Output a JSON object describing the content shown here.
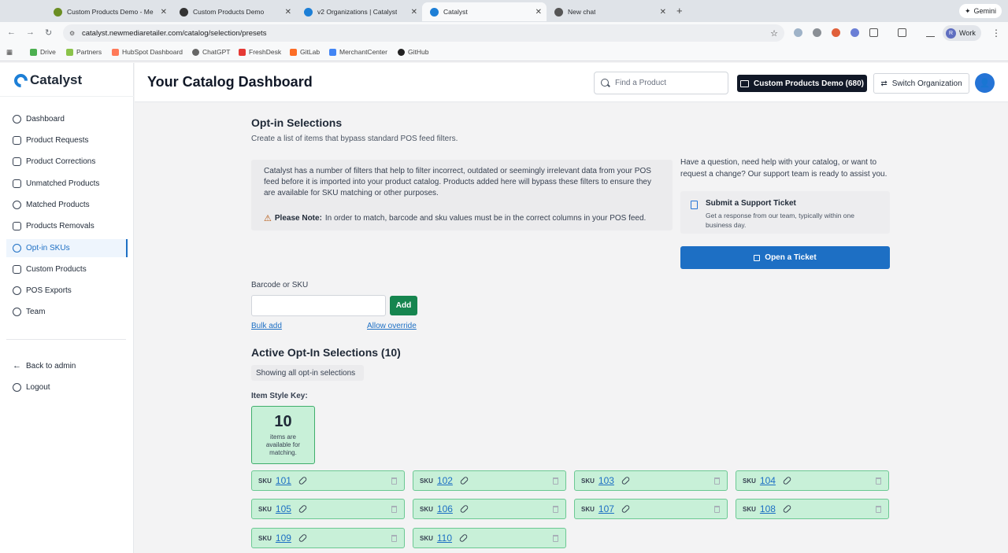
{
  "browser": {
    "tabs": [
      {
        "label": "Custom Products Demo - Me",
        "icon_color": "#6b8e23"
      },
      {
        "label": "Custom Products Demo",
        "icon_color": "#333333"
      },
      {
        "label": "v2 Organizations | Catalyst",
        "icon_color": "#1d7fd6"
      },
      {
        "label": "Catalyst",
        "icon_color": "#1d7fd6"
      },
      {
        "label": "New chat",
        "icon_color": "#555555"
      }
    ],
    "gemini_label": "Gemini",
    "url": "catalyst.newmediaretailer.com/catalog/selection/presets",
    "profile_label": "Work",
    "profile_initial": "R",
    "bookmarks": [
      "Drive",
      "Partners",
      "HubSpot Dashboard",
      "ChatGPT",
      "FreshDesk",
      "GitLab",
      "MerchantCenter",
      "GitHub"
    ]
  },
  "app": {
    "logo_text": "Catalyst",
    "page_title": "Your Catalog Dashboard",
    "search_placeholder": "Find a Product",
    "org_button": "Custom Products Demo (680)",
    "switch_org": "Switch Organization",
    "accent": "#1d6fc4"
  },
  "sidebar": {
    "items": [
      {
        "label": "Dashboard",
        "icon": "dashboard-icon"
      },
      {
        "label": "Product Requests",
        "icon": "list-icon"
      },
      {
        "label": "Product Corrections",
        "icon": "edit-icon"
      },
      {
        "label": "Unmatched Products",
        "icon": "inbox-icon"
      },
      {
        "label": "Matched Products",
        "icon": "check-circle-icon"
      },
      {
        "label": "Products Removals",
        "icon": "trash-icon"
      },
      {
        "label": "Opt-in SKUs",
        "icon": "gear-icon",
        "active": true
      },
      {
        "label": "Custom Products",
        "icon": "box-icon"
      },
      {
        "label": "POS Exports",
        "icon": "users-icon"
      },
      {
        "label": "Team",
        "icon": "team-icon"
      }
    ],
    "footer": [
      {
        "label": "Back to admin",
        "icon": "arrow-left-icon"
      },
      {
        "label": "Logout",
        "icon": "power-icon"
      }
    ]
  },
  "main": {
    "title": "Opt-in Selections",
    "subtitle": "Create a list of items that bypass standard POS feed filters.",
    "info_text": "Catalyst has a number of filters that help to filter incorrect, outdated or seemingly irrelevant data from your POS feed before it is imported into your product catalog. Products added here will bypass these filters to ensure they are available for SKU matching or other purposes.",
    "note_label": "Please Note:",
    "note_text": "In order to match, barcode and sku values must be in the correct columns in your POS feed.",
    "help_text": "Have a question, need help with your catalog, or want to request a change? Our support team is ready to assist you.",
    "ticket_title": "Submit a Support Ticket",
    "ticket_desc": "Get a response from our team, typically within one business day.",
    "open_ticket": "Open a Ticket",
    "field_label": "Barcode or SKU",
    "add_button": "Add",
    "bulk_add": "Bulk add",
    "allow_override": "Allow override",
    "active_title": "Active Opt-In Selections (10)",
    "showing": "Showing all opt-in selections",
    "key_label": "Item Style Key:",
    "key_count": "10",
    "key_desc": "items are available for matching.",
    "sku_label": "SKU",
    "skus": [
      "101",
      "102",
      "103",
      "104",
      "105",
      "106",
      "107",
      "108",
      "109",
      "110"
    ]
  }
}
